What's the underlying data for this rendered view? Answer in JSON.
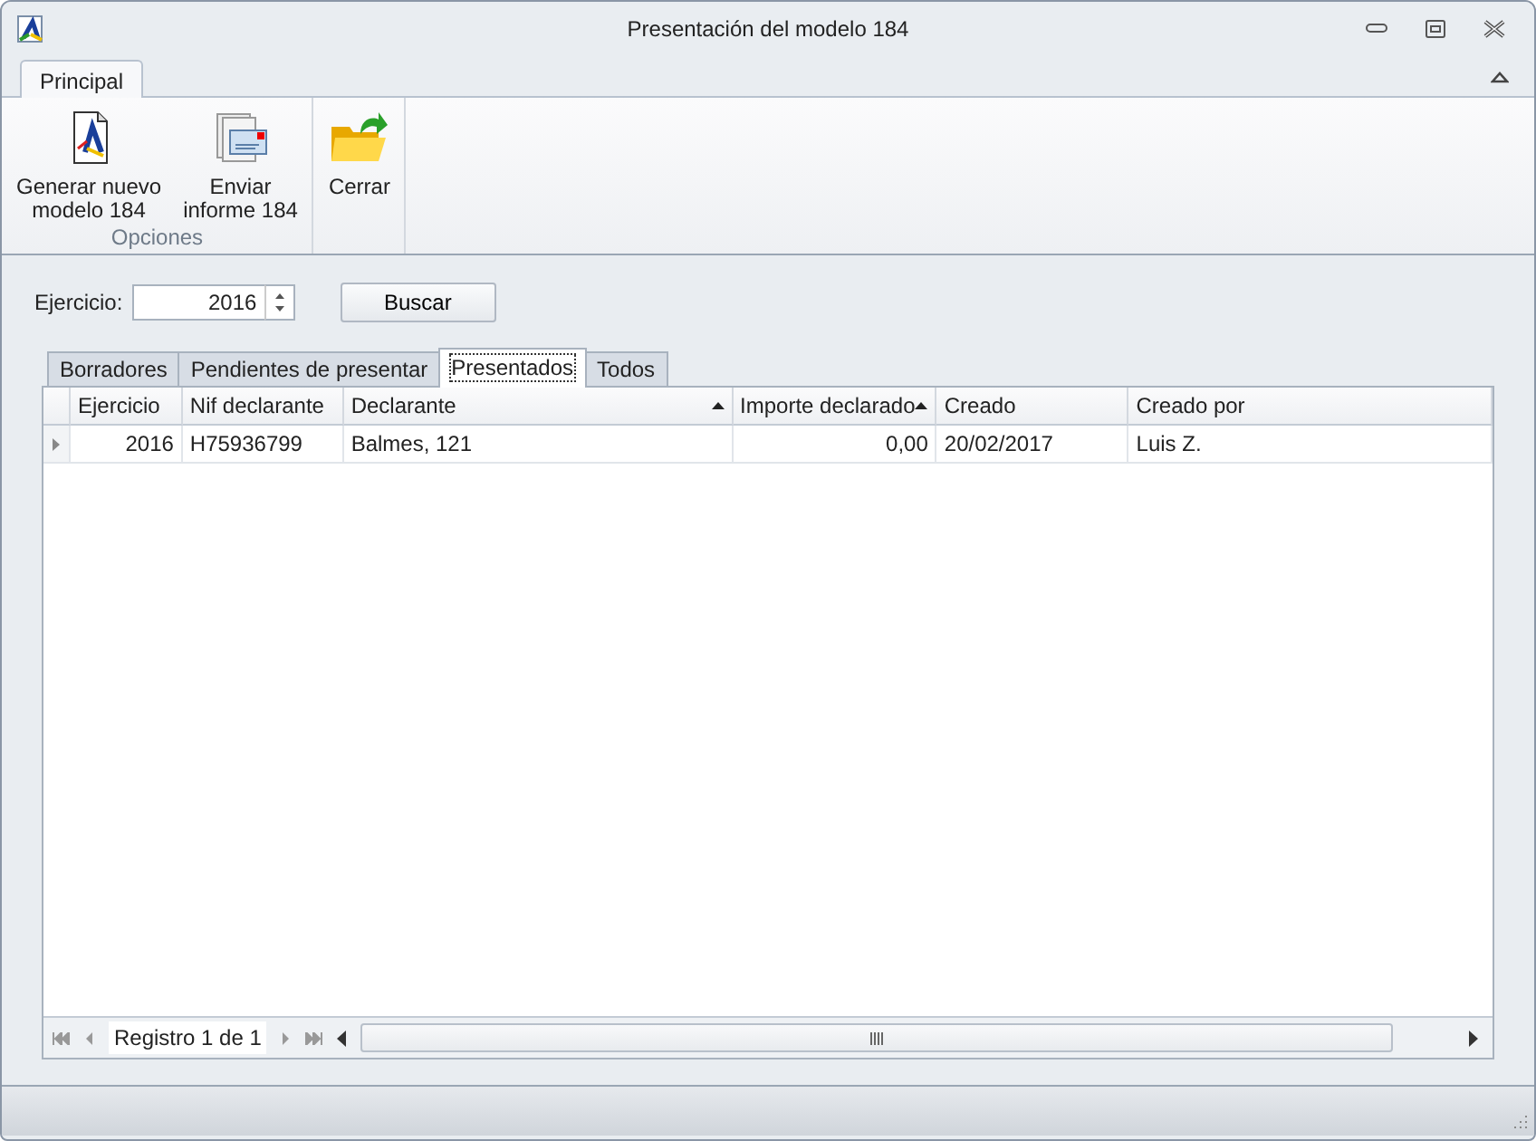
{
  "window": {
    "title": "Presentación del modelo 184"
  },
  "ribbon": {
    "tabs": [
      {
        "label": "Principal",
        "selected": true
      }
    ],
    "groups": [
      {
        "label": "Opciones",
        "buttons": [
          {
            "kind": "document",
            "lines": [
              "Generar nuevo",
              "modelo 184"
            ]
          },
          {
            "kind": "report",
            "lines": [
              "Enviar",
              "informe 184"
            ]
          }
        ]
      },
      {
        "buttons": [
          {
            "kind": "folder",
            "lines": [
              "Cerrar"
            ]
          }
        ]
      }
    ]
  },
  "filter": {
    "label": "Ejercicio:",
    "value": "2016",
    "button": "Buscar"
  },
  "tabs": [
    {
      "label": "Borradores",
      "selected": false
    },
    {
      "label": "Pendientes de presentar",
      "selected": false
    },
    {
      "label": "Presentados",
      "selected": true
    },
    {
      "label": "Todos",
      "selected": false
    }
  ],
  "table": {
    "columns": [
      {
        "label": "Ejercicio",
        "kind": "number",
        "sorted": false
      },
      {
        "label": "Nif declarante",
        "kind": "text",
        "sorted": false
      },
      {
        "label": "Declarante",
        "kind": "text",
        "sorted": true
      },
      {
        "label": "Importe declarado",
        "kind": "number",
        "sorted": true
      },
      {
        "label": "Creado",
        "kind": "text",
        "sorted": false
      },
      {
        "label": "Creado por",
        "kind": "text",
        "sorted": false
      }
    ],
    "rows": [
      {
        "current": true,
        "cells": [
          "2016",
          "H75936799",
          "Balmes, 121",
          "0,00",
          "20/02/2017",
          "Luis Z."
        ]
      }
    ]
  },
  "navigator": {
    "text": "Registro 1 de 1"
  }
}
